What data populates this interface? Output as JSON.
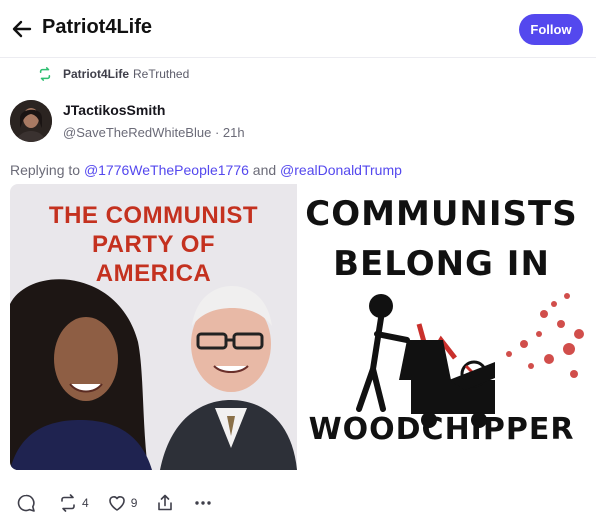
{
  "header": {
    "title": "Patriot4Life",
    "follow_label": "Follow"
  },
  "retruth": {
    "user": "Patriot4Life",
    "label": "ReTruthed"
  },
  "author": {
    "display_name": "JTactikosSmith",
    "handle": "@SaveTheRedWhiteBlue",
    "separator": "·",
    "time": "21h"
  },
  "reply": {
    "prefix": "Replying to",
    "mention_1": "@1776WeThePeople1776",
    "conjunction": "and",
    "mention_2": "@realDonaldTrump"
  },
  "media": {
    "image_1": {
      "line_1": "THE COMMUNIST",
      "line_2": "PARTY OF",
      "line_3": "AMERICA"
    },
    "image_2": {
      "line_1": "COMMUNISTS",
      "line_2": "BELONG IN",
      "line_3": "WOODCHIPPER"
    }
  },
  "actions": {
    "reply_count": "",
    "retruth_count": "4",
    "like_count": "9"
  },
  "colors": {
    "accent": "#5448ee",
    "retruth_green": "#2fbf71",
    "meme_red": "#c4311f"
  }
}
